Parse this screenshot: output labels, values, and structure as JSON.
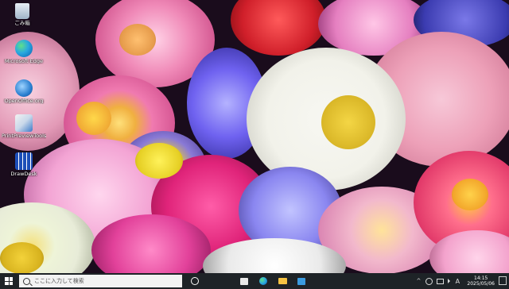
{
  "desktop": {
    "icons": [
      {
        "label": "ごみ箱",
        "icon": "recycle-bin-icon"
      },
      {
        "label": "Microsoft Edge",
        "icon": "edge-icon"
      },
      {
        "label": "OpenOffice.org",
        "icon": "openoffice-icon"
      },
      {
        "label": "PrintPreviewTools",
        "icon": "print-tools-icon"
      },
      {
        "label": "DrawDesk",
        "icon": "grid-app-icon"
      }
    ]
  },
  "taskbar": {
    "search_placeholder": "ここに入力して検索",
    "pinned": [
      "task-view-icon",
      "file-explorer-icon",
      "edge-icon",
      "folder-icon",
      "store-icon"
    ],
    "tray": {
      "ime_mode": "A",
      "time": "14:15",
      "date": "2025/05/06"
    }
  },
  "colors": {
    "taskbar_bg": "#1e2327",
    "accent": "#0078d4"
  }
}
